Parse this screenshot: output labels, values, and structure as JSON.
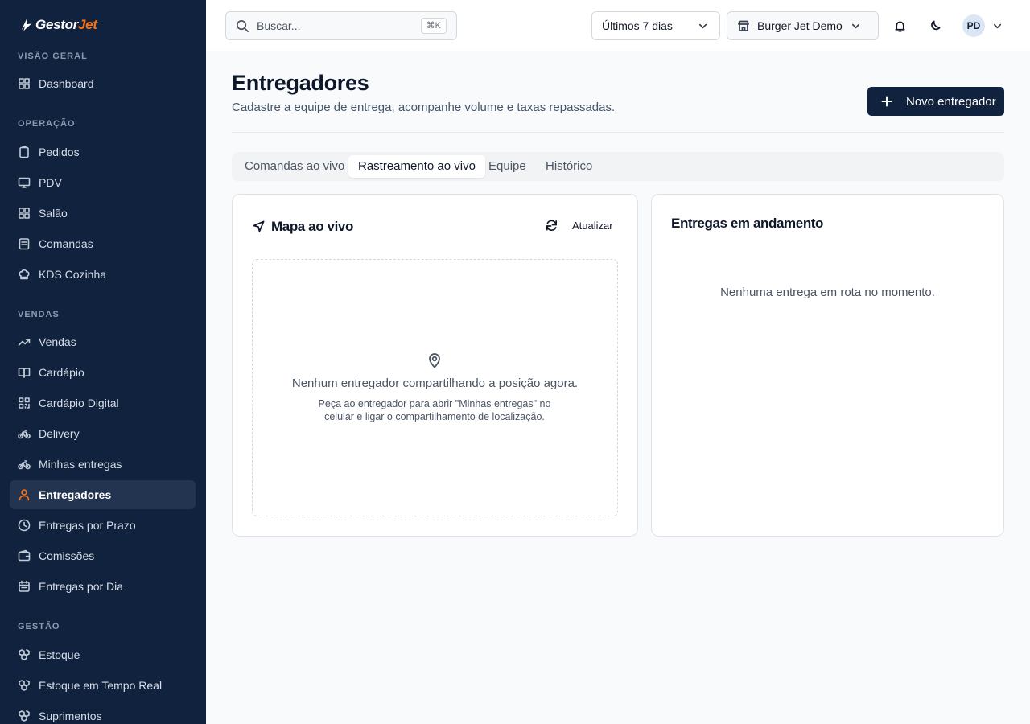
{
  "brand": {
    "name_part1": "Gestor",
    "name_part2": "Jet",
    "accent_color": "#f97316",
    "sidebar_bg": "#10223d"
  },
  "sidebar": {
    "sections": [
      {
        "label": "VISÃO GERAL"
      },
      {
        "label": "OPERAÇÃO"
      },
      {
        "label": "VENDAS"
      },
      {
        "label": "GESTÃO"
      }
    ],
    "items": [
      {
        "label": "Dashboard",
        "icon": "grid-icon"
      },
      {
        "label": "Pedidos",
        "icon": "clipboard-icon"
      },
      {
        "label": "PDV",
        "icon": "monitor-icon"
      },
      {
        "label": "Salão",
        "icon": "grid-icon"
      },
      {
        "label": "Comandas",
        "icon": "list-icon"
      },
      {
        "label": "KDS Cozinha",
        "icon": "chef-hat-icon"
      },
      {
        "label": "Vendas",
        "icon": "trend-up-icon"
      },
      {
        "label": "Cardápio",
        "icon": "book-icon"
      },
      {
        "label": "Cardápio Digital",
        "icon": "qr-icon"
      },
      {
        "label": "Delivery",
        "icon": "bike-icon"
      },
      {
        "label": "Minhas entregas",
        "icon": "bike-icon"
      },
      {
        "label": "Entregadores",
        "icon": "user-icon",
        "active": true
      },
      {
        "label": "Entregas por Prazo",
        "icon": "clock-icon"
      },
      {
        "label": "Comissões",
        "icon": "wallet-icon"
      },
      {
        "label": "Entregas por Dia",
        "icon": "calendar-icon"
      },
      {
        "label": "Estoque",
        "icon": "boxes-icon"
      },
      {
        "label": "Estoque em Tempo Real",
        "icon": "boxes-icon"
      },
      {
        "label": "Suprimentos",
        "icon": "boxes-icon"
      }
    ]
  },
  "topbar": {
    "search_placeholder": "Buscar...",
    "search_shortcut": "⌘K",
    "period": "Últimos 7 dias",
    "store": "Burger Jet Demo",
    "avatar_initials": "PD"
  },
  "header": {
    "title": "Entregadores",
    "subtitle": "Cadastre a equipe de entrega, acompanhe volume e taxas repassadas.",
    "new_button": "Novo entregador"
  },
  "tabs": [
    {
      "label": "Comandas ao vivo"
    },
    {
      "label": "Rastreamento ao vivo",
      "active": true
    },
    {
      "label": "Equipe"
    },
    {
      "label": "Histórico"
    }
  ],
  "map_card": {
    "title": "Mapa ao vivo",
    "refresh": "Atualizar",
    "empty_title": "Nenhum entregador compartilhando a posição agora.",
    "empty_hint": "Peça ao entregador para abrir \"Minhas entregas\" no celular e ligar o compartilhamento de localização."
  },
  "deliveries_card": {
    "title": "Entregas em andamento",
    "empty": "Nenhuma entrega em rota no momento."
  }
}
